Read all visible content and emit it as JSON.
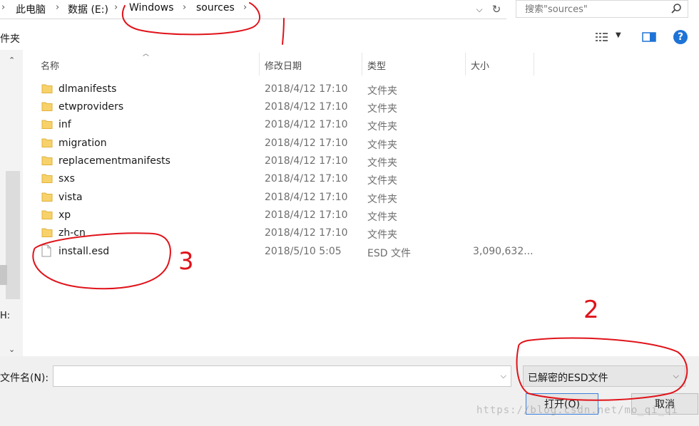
{
  "address_bar": {
    "crumbs": [
      "此电脑",
      "数据 (E:)",
      "Windows",
      "sources"
    ]
  },
  "search": {
    "placeholder": "搜索\"sources\""
  },
  "toolbar": {
    "left_label": "件夹"
  },
  "nav_pane": {
    "partial_label": "H:"
  },
  "file_list": {
    "columns": [
      "名称",
      "修改日期",
      "类型",
      "大小"
    ],
    "rows": [
      {
        "name": "dlmanifests",
        "date": "2018/4/12 17:10",
        "type": "文件夹",
        "size": "",
        "icon": "folder-icon"
      },
      {
        "name": "etwproviders",
        "date": "2018/4/12 17:10",
        "type": "文件夹",
        "size": "",
        "icon": "folder-icon"
      },
      {
        "name": "inf",
        "date": "2018/4/12 17:10",
        "type": "文件夹",
        "size": "",
        "icon": "folder-icon"
      },
      {
        "name": "migration",
        "date": "2018/4/12 17:10",
        "type": "文件夹",
        "size": "",
        "icon": "folder-icon"
      },
      {
        "name": "replacementmanifests",
        "date": "2018/4/12 17:10",
        "type": "文件夹",
        "size": "",
        "icon": "folder-icon"
      },
      {
        "name": "sxs",
        "date": "2018/4/12 17:10",
        "type": "文件夹",
        "size": "",
        "icon": "folder-icon"
      },
      {
        "name": "vista",
        "date": "2018/4/12 17:10",
        "type": "文件夹",
        "size": "",
        "icon": "folder-icon"
      },
      {
        "name": "xp",
        "date": "2018/4/12 17:10",
        "type": "文件夹",
        "size": "",
        "icon": "folder-icon"
      },
      {
        "name": "zh-cn",
        "date": "2018/4/12 17:10",
        "type": "文件夹",
        "size": "",
        "icon": "folder-icon"
      },
      {
        "name": "install.esd",
        "date": "2018/5/10 5:05",
        "type": "ESD 文件",
        "size": "3,090,632...",
        "icon": "file-icon"
      }
    ]
  },
  "bottom": {
    "filename_label": "文件名(N):",
    "filename_value": "",
    "filter_value": "已解密的ESD文件",
    "open_label": "打开(O)",
    "cancel_label": "取消"
  },
  "watermark": "https://blog.csdn.net/mo_qi_qi",
  "annotations": {
    "color": "#e0131a",
    "numbers": [
      "2",
      "3"
    ]
  },
  "colors": {
    "accent": "#1e73d6",
    "folder": "#f7d26a",
    "folder_dark": "#e2b13c"
  }
}
